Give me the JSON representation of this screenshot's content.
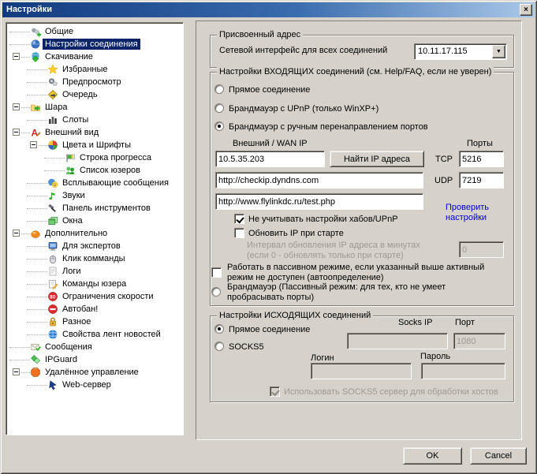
{
  "window": {
    "title": "Настройки",
    "close_glyph": "×",
    "dropdown_glyph": "▼"
  },
  "tree": {
    "items": [
      {
        "key": "general",
        "label": "Общие",
        "level": 0,
        "icon": "users-plus",
        "expandable": false,
        "selected": false
      },
      {
        "key": "connection-settings",
        "label": "Настройки соединения",
        "level": 0,
        "icon": "orb",
        "expandable": false,
        "selected": true
      },
      {
        "key": "downloads",
        "label": "Скачивание",
        "level": 0,
        "icon": "globe-down",
        "expandable": true,
        "selected": false
      },
      {
        "key": "favorites",
        "label": "Избранные",
        "level": 1,
        "icon": "star",
        "expandable": false,
        "selected": false
      },
      {
        "key": "preview",
        "label": "Предпросмотр",
        "level": 1,
        "icon": "preview",
        "expandable": false,
        "selected": false
      },
      {
        "key": "queue",
        "label": "Очередь",
        "level": 1,
        "icon": "queue",
        "expandable": false,
        "selected": false
      },
      {
        "key": "share",
        "label": "Шара",
        "level": 0,
        "icon": "folder-share",
        "expandable": true,
        "selected": false
      },
      {
        "key": "slots",
        "label": "Слоты",
        "level": 1,
        "icon": "slots",
        "expandable": false,
        "selected": false
      },
      {
        "key": "appearance",
        "label": "Внешний вид",
        "level": 0,
        "icon": "appearance",
        "expandable": true,
        "selected": false
      },
      {
        "key": "colors-fonts",
        "label": "Цвета и Шрифты",
        "level": 1,
        "icon": "color-wheel",
        "expandable": true,
        "selected": false
      },
      {
        "key": "progress-bar",
        "label": "Строка прогресса",
        "level": 2,
        "icon": "progress",
        "expandable": false,
        "selected": false
      },
      {
        "key": "user-list",
        "label": "Список юзеров",
        "level": 2,
        "icon": "users-green",
        "expandable": false,
        "selected": false
      },
      {
        "key": "popups",
        "label": "Всплывающие сообщения",
        "level": 1,
        "icon": "popup",
        "expandable": false,
        "selected": false
      },
      {
        "key": "sounds",
        "label": "Звуки",
        "level": 1,
        "icon": "sound",
        "expandable": false,
        "selected": false
      },
      {
        "key": "toolbar",
        "label": "Панель инструментов",
        "level": 1,
        "icon": "toolbar",
        "expandable": false,
        "selected": false
      },
      {
        "key": "windows",
        "label": "Окна",
        "level": 1,
        "icon": "windows",
        "expandable": false,
        "selected": false
      },
      {
        "key": "advanced",
        "label": "Дополнительно",
        "level": 0,
        "icon": "advanced",
        "expandable": true,
        "selected": false
      },
      {
        "key": "experts",
        "label": "Для экспертов",
        "level": 1,
        "icon": "monitor",
        "expandable": false,
        "selected": false
      },
      {
        "key": "click-commands",
        "label": "Клик комманды",
        "level": 1,
        "icon": "mouse",
        "expandable": false,
        "selected": false
      },
      {
        "key": "logs",
        "label": "Логи",
        "level": 1,
        "icon": "logs",
        "expandable": false,
        "selected": false
      },
      {
        "key": "user-commands",
        "label": "Команды юзера",
        "level": 1,
        "icon": "notepad",
        "expandable": false,
        "selected": false
      },
      {
        "key": "speed-limits",
        "label": "Ограничения скорости",
        "level": 1,
        "icon": "speed",
        "expandable": false,
        "selected": false
      },
      {
        "key": "autoban",
        "label": "Автобан!",
        "level": 1,
        "icon": "ban",
        "expandable": false,
        "selected": false
      },
      {
        "key": "misc",
        "label": "Разное",
        "level": 1,
        "icon": "lock",
        "expandable": false,
        "selected": false
      },
      {
        "key": "news-feeds",
        "label": "Свойства лент новостей",
        "level": 1,
        "icon": "news",
        "expandable": false,
        "selected": false
      },
      {
        "key": "messages",
        "label": "Сообщения",
        "level": 0,
        "icon": "mail",
        "expandable": false,
        "selected": false
      },
      {
        "key": "ipguard",
        "label": "IPGuard",
        "level": 0,
        "icon": "ipguard",
        "expandable": false,
        "selected": false
      },
      {
        "key": "remote-control",
        "label": "Удалённое управление",
        "level": 0,
        "icon": "remote",
        "expandable": true,
        "selected": false
      },
      {
        "key": "web-server",
        "label": "Web-сервер",
        "level": 1,
        "icon": "webserver",
        "expandable": false,
        "selected": false
      }
    ]
  },
  "assigned_group": {
    "legend": "Присвоенный адрес",
    "interface_label": "Сетевой интерфейс для всех соединений",
    "interface_value": "10.11.17.115"
  },
  "incoming_group": {
    "legend": "Настройки ВХОДЯЩИХ соединений (см. Help/FAQ, если не уверен)",
    "direct": "Прямое соединение",
    "upnp": "Брандмауэр с UPnP (только WinXP+)",
    "manual": "Брандмауэр с ручным перенаправлением портов",
    "wan_label": "Внешний / WAN IP",
    "ports_label": "Порты",
    "wan_ip": "10.5.35.203",
    "find_ip_button": "Найти IP адреса",
    "tcp_label": "TCP",
    "tcp_port": "5216",
    "url1": "http://checkip.dyndns.com",
    "udp_label": "UDP",
    "udp_port": "7219",
    "url2": "http://www.flylinkdc.ru/test.php",
    "check_link_line1": "Проверить",
    "check_link_line2": "настройки",
    "ignore_hubs": "Не учитывать настройки хабов/UPnP",
    "update_on_start": "Обновить IP при старте",
    "interval_line1": "Интервал обновления IP адреса в минутах",
    "interval_line2": "(если 0 - обновлять только при старте)",
    "interval_value": "0",
    "passive_fallback": "Работать в пассивном режиме, если указанный выше активный режим не доступен (автоопределение)",
    "firewall_passive": "Брандмауэр (Пассивный режим: для тех, кто не умеет пробрасывать порты)"
  },
  "outgoing_group": {
    "legend": "Настройки ИСХОДЯЩИХ соединений",
    "direct": "Прямое соединение",
    "socks5": "SOCKS5",
    "socks_ip_label": "Socks IP",
    "port_label": "Порт",
    "port_value": "1080",
    "login_label": "Логин",
    "password_label": "Пароль",
    "use_socks_resolve": "Использовать SOCKS5 сервер для обработки хостов"
  },
  "buttons": {
    "ok": "OK",
    "cancel": "Cancel"
  }
}
